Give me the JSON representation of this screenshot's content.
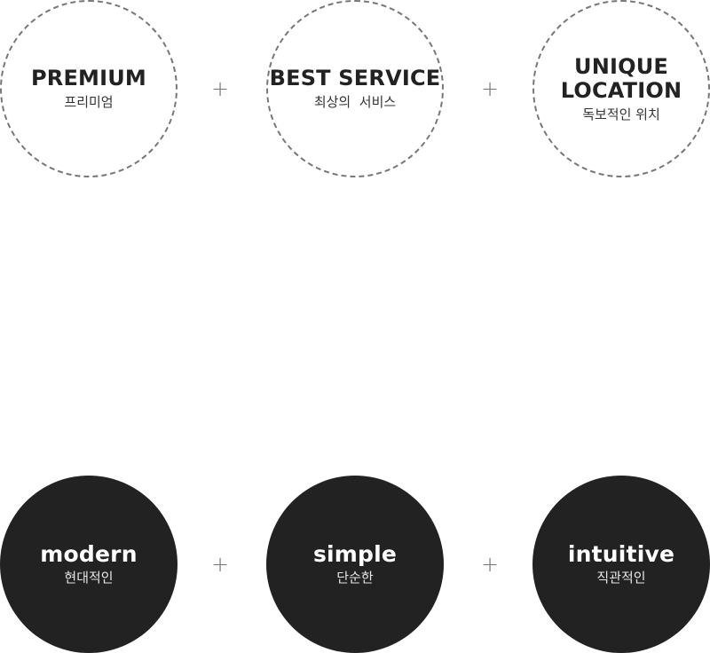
{
  "top_row": {
    "items": [
      {
        "title": "PREMIUM",
        "subtitle": "프리미엄"
      },
      {
        "title": "BEST SERVICE",
        "subtitle": "최상의  서비스"
      },
      {
        "title": "UNIQUE\nLOCATION",
        "subtitle": "독보적인 위치"
      }
    ],
    "separator": "+"
  },
  "bottom_row": {
    "items": [
      {
        "title": "modern",
        "subtitle": "현대적인"
      },
      {
        "title": "simple",
        "subtitle": "단순한"
      },
      {
        "title": "intuitive",
        "subtitle": "직관적인"
      }
    ],
    "separator": "+"
  },
  "colors": {
    "dark_fill": "#222222",
    "dashed_border": "#777777",
    "plus_sign": "#777777",
    "background": "#ffffff"
  }
}
